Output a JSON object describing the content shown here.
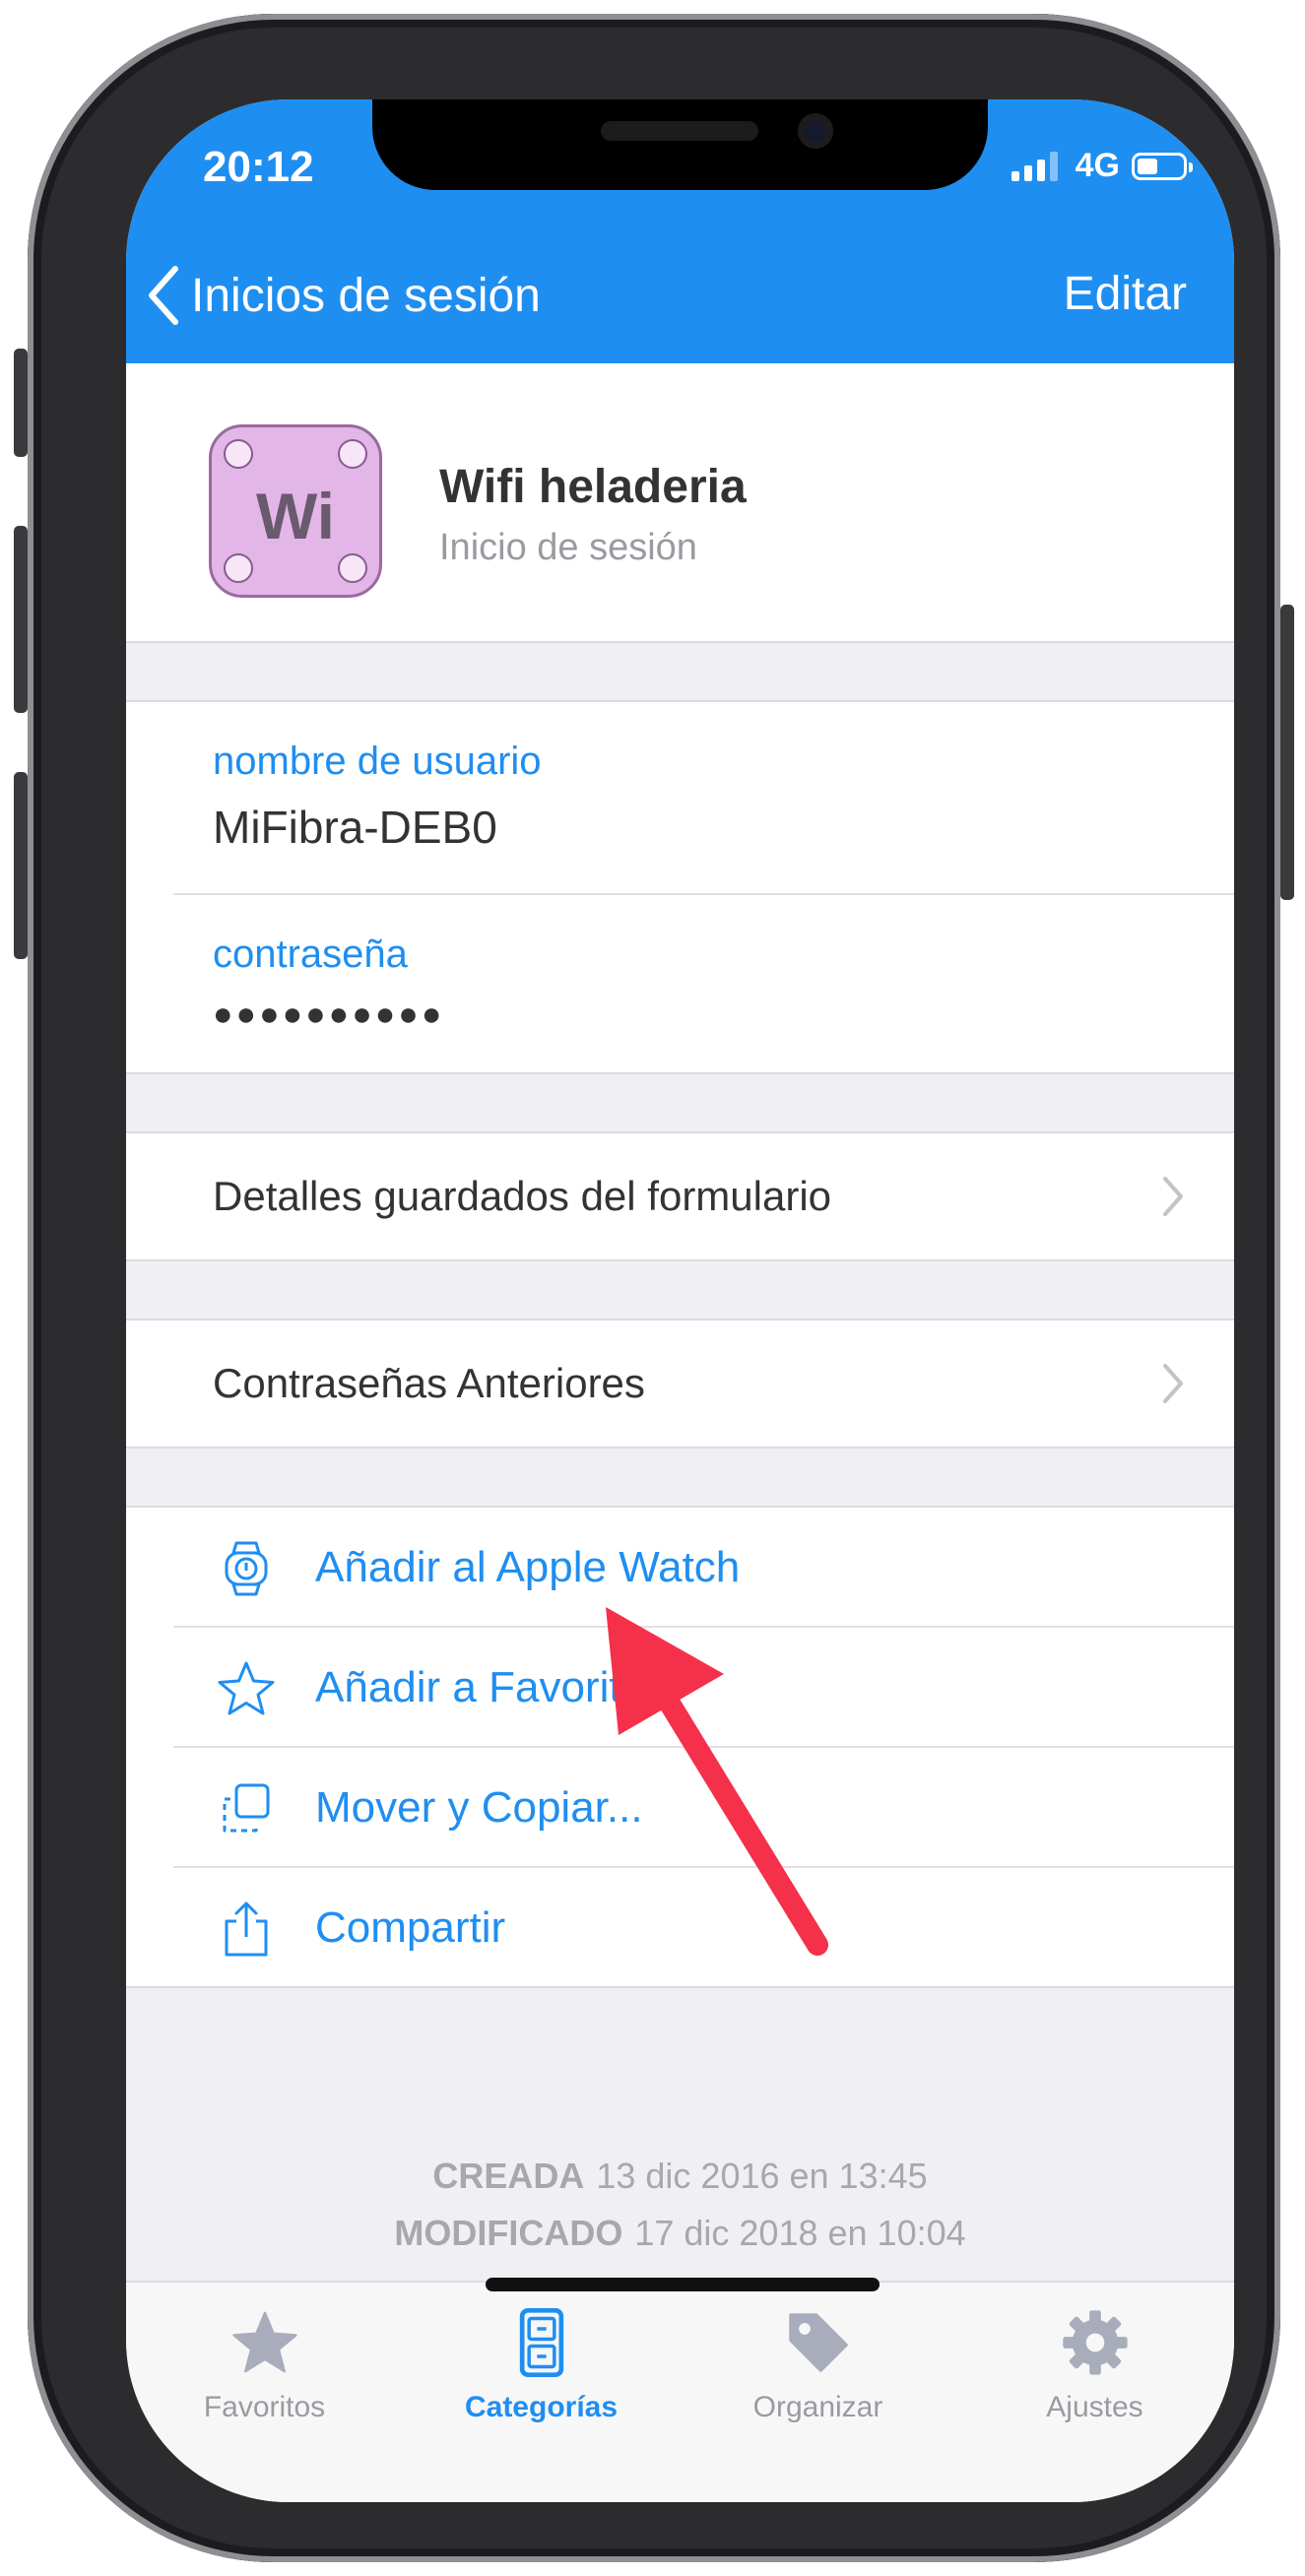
{
  "status_bar": {
    "time": "20:12",
    "network": "4G"
  },
  "nav": {
    "back_label": "Inicios de sesión",
    "edit_label": "Editar"
  },
  "item": {
    "icon_text": "Wi",
    "title": "Wifi heladeria",
    "subtitle": "Inicio de sesión"
  },
  "fields": {
    "username_label": "nombre de usuario",
    "username_value": "MiFibra-DEB0",
    "password_label": "contraseña",
    "password_value": "●●●●●●●●●●"
  },
  "rows": {
    "form_details": "Detalles guardados del formulario",
    "previous_passwords": "Contraseñas Anteriores"
  },
  "actions": [
    {
      "label": "Añadir al Apple Watch",
      "icon": "apple-watch-icon"
    },
    {
      "label": "Añadir a Favoritos",
      "icon": "star-outline-icon"
    },
    {
      "label": "Mover y Copiar...",
      "icon": "move-copy-icon"
    },
    {
      "label": "Compartir",
      "icon": "share-icon"
    }
  ],
  "meta": {
    "created_label": "CREADA",
    "created_value": "13 dic 2016 en 13:45",
    "modified_label": "MODIFICADO",
    "modified_value": "17 dic 2018 en 10:04"
  },
  "tabs": [
    {
      "label": "Favoritos",
      "icon": "star-icon",
      "active": false
    },
    {
      "label": "Categorías",
      "icon": "cabinet-icon",
      "active": true
    },
    {
      "label": "Organizar",
      "icon": "tag-icon",
      "active": false
    },
    {
      "label": "Ajustes",
      "icon": "gear-icon",
      "active": false
    }
  ],
  "colors": {
    "accent": "#1f8ef1",
    "annotation_arrow": "#f5304a",
    "icon_bg": "#e3b6e8"
  }
}
